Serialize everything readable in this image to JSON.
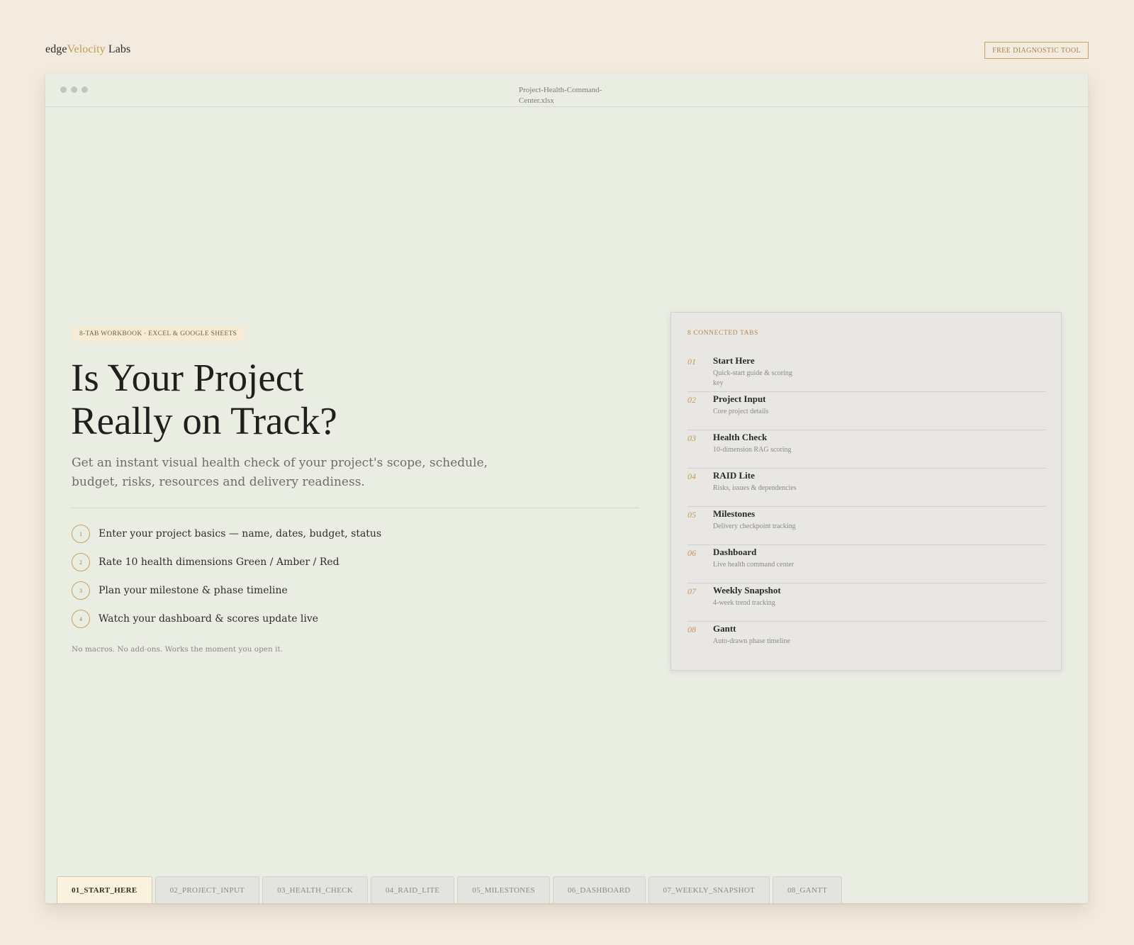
{
  "header": {
    "brand_part1": "edge",
    "brand_accent": "Velocity",
    "brand_part2": " Labs",
    "cta_label": "FREE DIAGNOSTIC TOOL"
  },
  "window": {
    "filename": "Project-Health-Command-Center.xlsx"
  },
  "hero": {
    "badge": "8-TAB WORKBOOK · EXCEL & GOOGLE SHEETS",
    "headline_line1": "Is Your Project",
    "headline_line2": "Really on Track?",
    "subhead": "Get an instant visual health check of your project's scope, schedule, budget, risks, resources and delivery readiness.",
    "steps": [
      {
        "num": "1",
        "text": "Enter your project basics — name, dates, budget, status"
      },
      {
        "num": "2",
        "text": "Rate 10 health dimensions Green / Amber / Red"
      },
      {
        "num": "3",
        "text": "Plan your milestone & phase timeline"
      },
      {
        "num": "4",
        "text": "Watch your dashboard & scores update live"
      }
    ],
    "footnote": "No macros. No add-ons. Works the moment you open it."
  },
  "panel": {
    "title": "8 CONNECTED TABS",
    "tabs": [
      {
        "num": "01",
        "name": "Start Here",
        "desc": "Quick-start guide & scoring key"
      },
      {
        "num": "02",
        "name": "Project Input",
        "desc": "Core project details"
      },
      {
        "num": "03",
        "name": "Health Check",
        "desc": "10-dimension RAG scoring"
      },
      {
        "num": "04",
        "name": "RAID Lite",
        "desc": "Risks, issues & dependencies"
      },
      {
        "num": "05",
        "name": "Milestones",
        "desc": "Delivery checkpoint tracking"
      },
      {
        "num": "06",
        "name": "Dashboard",
        "desc": "Live health command center"
      },
      {
        "num": "07",
        "name": "Weekly Snapshot",
        "desc": "4-week trend tracking"
      },
      {
        "num": "08",
        "name": "Gantt",
        "desc": "Auto-drawn phase timeline"
      }
    ]
  },
  "sheet_tabs": [
    {
      "label": "01_START_HERE",
      "active": true
    },
    {
      "label": "02_PROJECT_INPUT",
      "active": false
    },
    {
      "label": "03_HEALTH_CHECK",
      "active": false
    },
    {
      "label": "04_RAID_LITE",
      "active": false
    },
    {
      "label": "05_MILESTONES",
      "active": false
    },
    {
      "label": "06_DASHBOARD",
      "active": false
    },
    {
      "label": "07_WEEKLY_SNAPSHOT",
      "active": false
    },
    {
      "label": "08_GANTT",
      "active": false
    }
  ],
  "colors": {
    "page_bg": "#f3ebdf",
    "window_bg": "#e9ede2",
    "accent_gold": "#c39a4e",
    "active_tab_bg": "#fbf1df"
  }
}
